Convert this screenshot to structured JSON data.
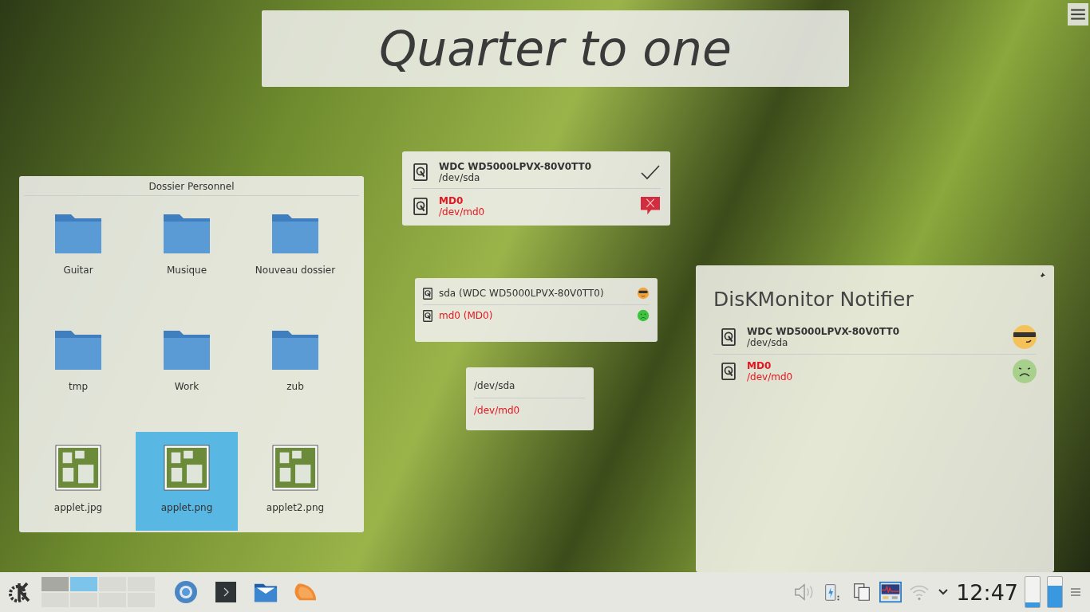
{
  "clock_widget": {
    "text": "Quarter to one"
  },
  "folder_view": {
    "title": "Dossier Personnel",
    "items": [
      {
        "label": "Guitar",
        "kind": "folder",
        "selected": false
      },
      {
        "label": "Musique",
        "kind": "folder",
        "selected": false
      },
      {
        "label": "Nouveau dossier",
        "kind": "folder",
        "selected": false
      },
      {
        "label": "tmp",
        "kind": "folder",
        "selected": false
      },
      {
        "label": "Work",
        "kind": "folder",
        "selected": false
      },
      {
        "label": "zub",
        "kind": "folder",
        "selected": false
      },
      {
        "label": "applet.jpg",
        "kind": "image",
        "selected": false
      },
      {
        "label": "applet.png",
        "kind": "image",
        "selected": true
      },
      {
        "label": "applet2.png",
        "kind": "image",
        "selected": false
      }
    ]
  },
  "disk_list": {
    "disks": [
      {
        "name": "WDC WD5000LPVX-80V0TT0",
        "device": "/dev/sda",
        "error": false
      },
      {
        "name": "MD0",
        "device": "/dev/md0",
        "error": true
      }
    ]
  },
  "disk_compact": {
    "disks": [
      {
        "label": "sda (WDC WD5000LPVX-80V0TT0)",
        "error": false
      },
      {
        "label": "md0 (MD0)",
        "error": true
      }
    ]
  },
  "device_list": {
    "devices": [
      {
        "device": "/dev/sda",
        "error": false
      },
      {
        "device": "/dev/md0",
        "error": true
      }
    ]
  },
  "notifier": {
    "title": "DisKMonitor Notifier",
    "disks": [
      {
        "name": "WDC WD5000LPVX-80V0TT0",
        "device": "/dev/sda",
        "error": false
      },
      {
        "name": "MD0",
        "device": "/dev/md0",
        "error": true
      }
    ]
  },
  "taskbar": {
    "desktops": [
      {
        "selected": false,
        "occupied": true
      },
      {
        "selected": true,
        "occupied": false
      },
      {
        "selected": false,
        "occupied": false
      },
      {
        "selected": false,
        "occupied": false
      },
      {
        "selected": false,
        "occupied": false
      },
      {
        "selected": false,
        "occupied": false
      },
      {
        "selected": false,
        "occupied": false
      },
      {
        "selected": false,
        "occupied": false
      }
    ],
    "clock": "12:47",
    "meters": [
      {
        "level": 0.15
      },
      {
        "level": 0.72
      }
    ]
  }
}
